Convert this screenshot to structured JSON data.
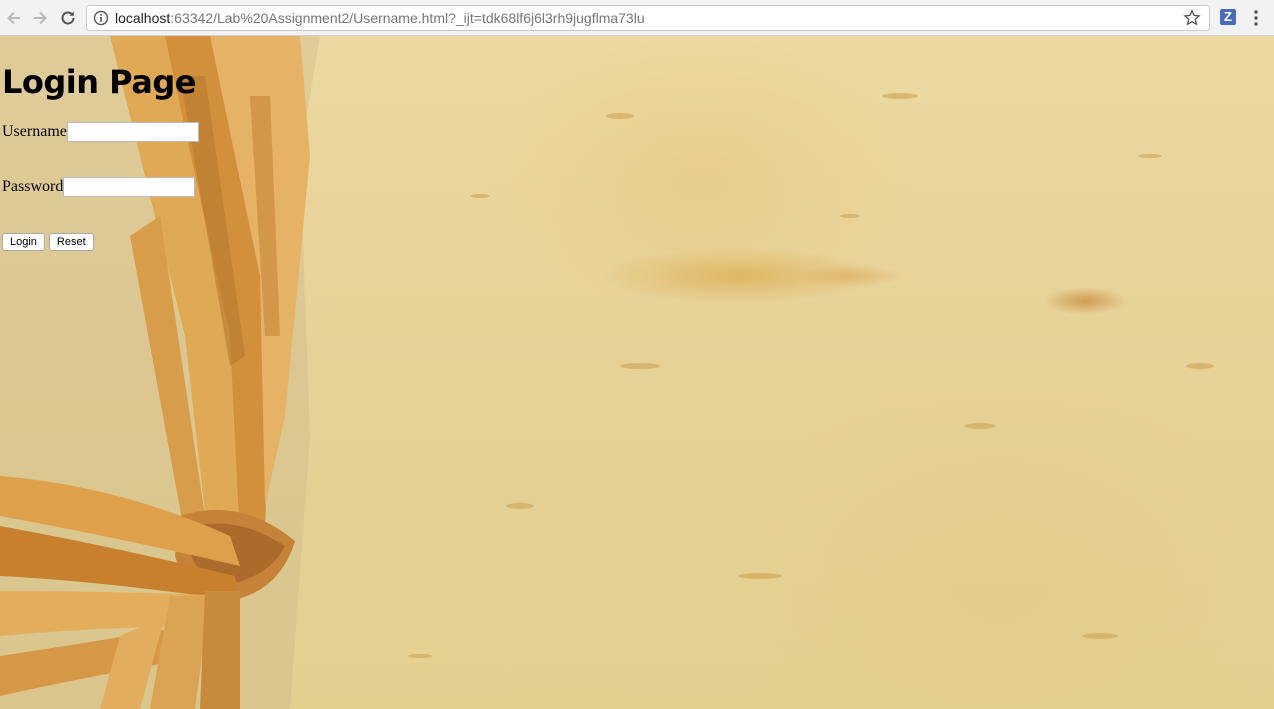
{
  "browser": {
    "url_host": "localhost",
    "url_rest": ":63342/Lab%20Assignment2/Username.html?_ijt=tdk68lf6j6l3rh9jugflma73lu",
    "extension_label": "Z"
  },
  "page": {
    "title": "Login Page",
    "username_label": "Username",
    "password_label": "Password",
    "username_value": "",
    "password_value": "",
    "login_label": "Login",
    "reset_label": "Reset"
  },
  "colors": {
    "background": "#e8d8a4",
    "straw": "#d9a24a"
  }
}
